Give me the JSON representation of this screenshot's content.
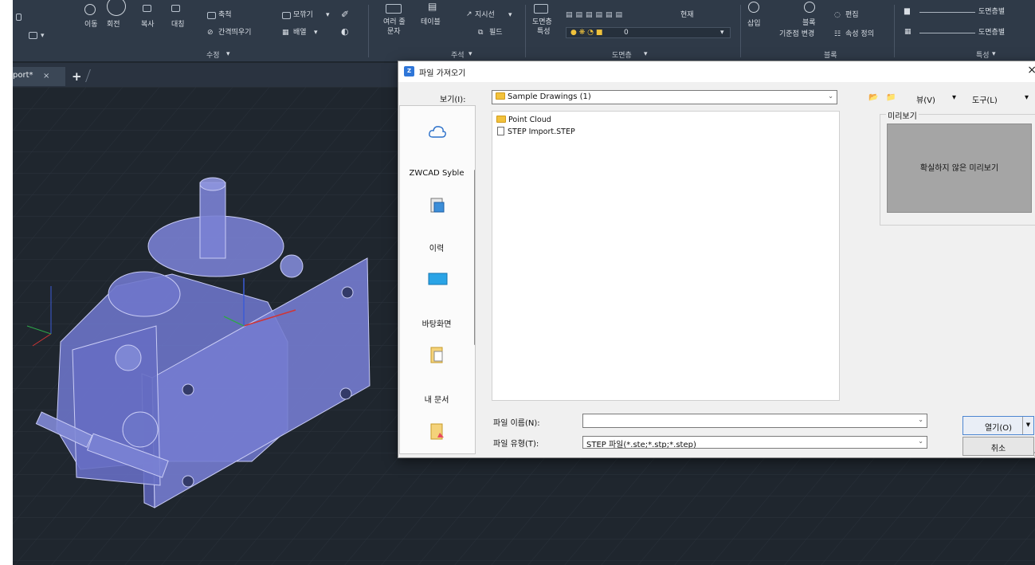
{
  "ribbon": {
    "modify_tools": [
      "이동",
      "회전",
      "복사",
      "대칭"
    ],
    "scale": "축척",
    "offset": "간격띄우기",
    "fillet": "모깎기",
    "array": "배열",
    "modify_panel": "수정",
    "multiline_text_line1": "여러 줄",
    "multiline_text_line2": "문자",
    "table": "테이블",
    "leader": "지시선",
    "field": "필드",
    "annotation_panel": "주석",
    "layer_props_line1": "도면층",
    "layer_props_line2": "특성",
    "current": "현재",
    "layer_value": "0",
    "layers_panel": "도면층",
    "insert": "삽입",
    "block_line1": "블록",
    "block_line2": "기준점 변경",
    "edit": "편집",
    "attr_define": "속성 정의",
    "block_panel": "블록",
    "bylayer_1": "도면층별",
    "bylayer_2": "도면층별",
    "properties_panel": "특성"
  },
  "tabs": {
    "doc_tab": "port*",
    "close": "×",
    "add": "+"
  },
  "dialog": {
    "title": "파일 가져오기",
    "close": "×",
    "look_in_label": "보기(I):",
    "look_in_value": "Sample Drawings (1)",
    "view_menu": "뷰(V)",
    "tools_menu": "도구(L)",
    "places": [
      {
        "label": ""
      },
      {
        "label": "ZWCAD Syble"
      },
      {
        "label": "이력"
      },
      {
        "label": "바탕화면"
      },
      {
        "label": "내 문서"
      }
    ],
    "files": [
      {
        "name": "Point Cloud",
        "type": "folder"
      },
      {
        "name": "STEP Import.STEP",
        "type": "file"
      }
    ],
    "preview_label": "미리보기",
    "preview_text": "확실하지 않은 미리보기",
    "filename_label": "파일 이름(N):",
    "filename_value": "",
    "filetype_label": "파일 유형(T):",
    "filetype_value": "STEP 파일(*.ste;*.stp;*.step)",
    "open_button": "열기(O)",
    "cancel_button": "취소"
  },
  "colors": {
    "ribbon_bg": "#2f3a48",
    "canvas_bg": "#1f262e",
    "model_fill": "#6c74c8",
    "dialog_bg": "#f0f0f0",
    "preview_bg": "#a5a5a5"
  }
}
